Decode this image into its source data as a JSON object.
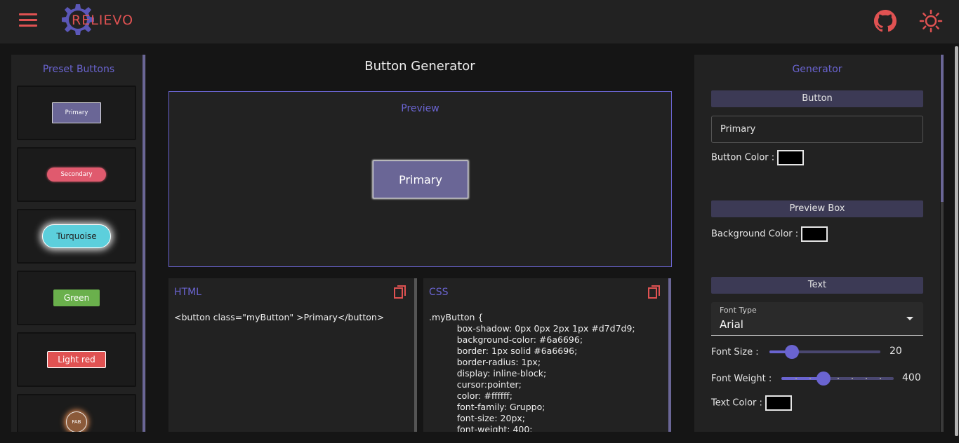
{
  "header": {
    "logo_text": "RELIEVO",
    "accent_color": "#e05252",
    "icons": [
      "menu-icon",
      "github-icon",
      "sun-icon"
    ]
  },
  "presets": {
    "title": "Preset Buttons",
    "items": [
      {
        "label": "Primary",
        "color": "#6a6696"
      },
      {
        "label": "Secondary",
        "color": "#e05a6e"
      },
      {
        "label": "Turquoise",
        "color": "#5ccfdc"
      },
      {
        "label": "Green",
        "color": "#6ab04c"
      },
      {
        "label": "Light red",
        "color": "#e05252"
      },
      {
        "label": "FAB",
        "color": "#8b5a3a"
      }
    ]
  },
  "main": {
    "title": "Button Generator",
    "preview_label": "Preview",
    "preview_button_label": "Primary",
    "html_panel": {
      "title": "HTML",
      "code": "<button class=\"myButton\" >Primary</button>"
    },
    "css_panel": {
      "title": "CSS",
      "code": ".myButton {\n          box-shadow: 0px 0px 2px 1px #d7d7d9;\n          background-color: #6a6696;\n          border: 1px solid #6a6696;\n          border-radius: 1px;\n          display: inline-block;\n          cursor:pointer;\n          color: #ffffff;\n          font-family: Gruppo;\n          font-size: 20px;\n          font-weight: 400;"
    }
  },
  "generator": {
    "title": "Generator",
    "button_section": "Button",
    "button_text_value": "Primary",
    "button_color_label": "Button Color :",
    "preview_box_section": "Preview Box",
    "background_color_label": "Background Color :",
    "text_section": "Text",
    "font_type_label": "Font Type",
    "font_type_value": "Arial",
    "font_size_label": "Font Size :",
    "font_size_value": "20",
    "font_size_fraction": 0.2,
    "font_weight_label": "Font Weight :",
    "font_weight_value": "400",
    "font_weight_fraction": 0.375,
    "text_color_label": "Text Color :"
  }
}
